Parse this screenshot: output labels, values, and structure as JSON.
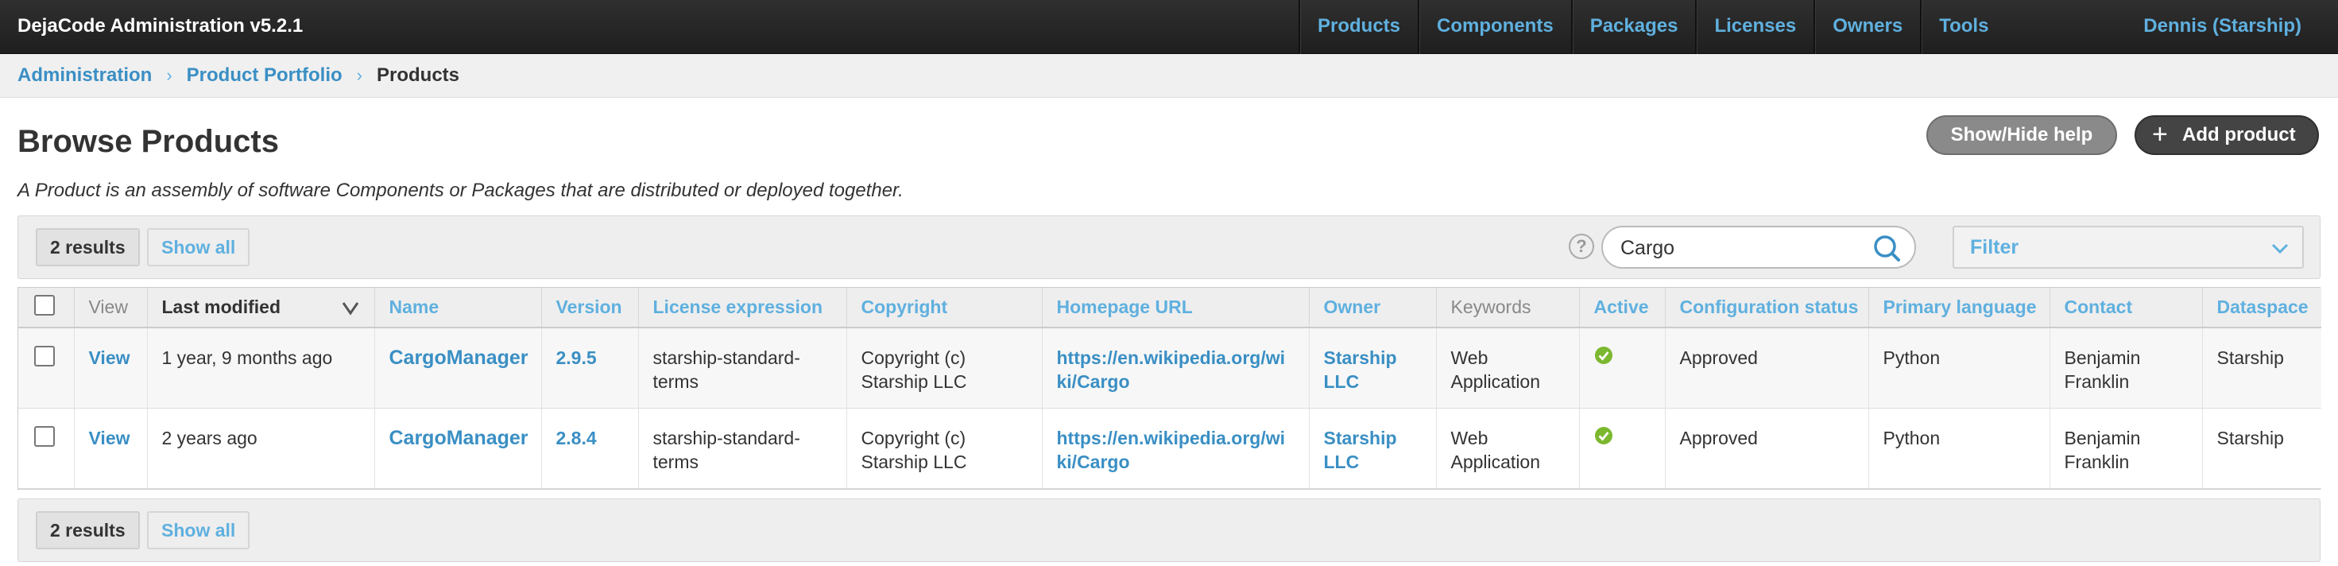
{
  "app": {
    "title": "DejaCode Administration v5.2.1"
  },
  "nav": {
    "items": [
      {
        "label": "Products"
      },
      {
        "label": "Components"
      },
      {
        "label": "Packages"
      },
      {
        "label": "Licenses"
      },
      {
        "label": "Owners"
      },
      {
        "label": "Tools"
      }
    ],
    "user": "Dennis (Starship)"
  },
  "breadcrumb": {
    "items": [
      "Administration",
      "Product Portfolio"
    ],
    "current": "Products",
    "separator": "›"
  },
  "page": {
    "title": "Browse Products",
    "description": "A Product is an assembly of software Components or Packages that are distributed or deployed together.",
    "help_button": "Show/Hide help",
    "add_button": "Add product"
  },
  "toolbar": {
    "results": "2 results",
    "show_all": "Show all",
    "help_glyph": "?",
    "search_value": "Cargo",
    "search_icon": "search-icon",
    "filter_label": "Filter"
  },
  "table": {
    "columns": {
      "view": "View",
      "last_modified": "Last modified",
      "name": "Name",
      "version": "Version",
      "license_expression": "License expression",
      "copyright": "Copyright",
      "homepage_url": "Homepage URL",
      "owner": "Owner",
      "keywords": "Keywords",
      "active": "Active",
      "configuration_status": "Configuration status",
      "primary_language": "Primary language",
      "contact": "Contact",
      "dataspace": "Dataspace"
    },
    "rows": [
      {
        "view": "View",
        "last_modified": "1 year, 9 months ago",
        "name": "CargoManager",
        "version": "2.9.5",
        "license_expression": "starship-standard-terms",
        "copyright": "Copyright (c) Starship LLC",
        "homepage_url": "https://en.wikipedia.org/wiki/Cargo",
        "owner": "Starship LLC",
        "keywords": "Web Application",
        "active": true,
        "configuration_status": "Approved",
        "primary_language": "Python",
        "contact": "Benjamin Franklin",
        "dataspace": "Starship"
      },
      {
        "view": "View",
        "last_modified": "2 years ago",
        "name": "CargoManager",
        "version": "2.8.4",
        "license_expression": "starship-standard-terms",
        "copyright": "Copyright (c) Starship LLC",
        "homepage_url": "https://en.wikipedia.org/wiki/Cargo",
        "owner": "Starship LLC",
        "keywords": "Web Application",
        "active": true,
        "configuration_status": "Approved",
        "primary_language": "Python",
        "contact": "Benjamin Franklin",
        "dataspace": "Starship"
      }
    ]
  },
  "colors": {
    "navbar": "#262626",
    "link": "#3a8fc4",
    "nav_link": "#5fb0df",
    "active_check": "#7cb82f"
  }
}
